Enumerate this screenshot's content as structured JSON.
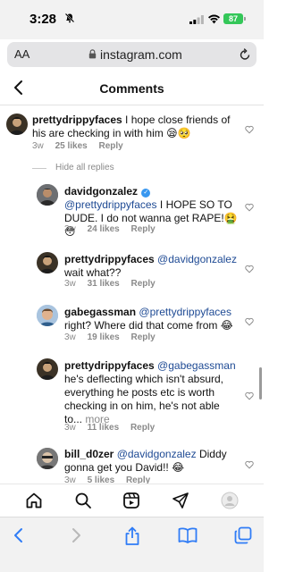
{
  "status_bar": {
    "time": "3:28",
    "battery": "87"
  },
  "url_bar": {
    "text_size_label": "AA",
    "domain": "instagram.com"
  },
  "header": {
    "title": "Comments"
  },
  "comments": [
    {
      "username": "prettydrippyfaces",
      "text": "I hope close friends of his are checking in with him 😪🥺",
      "age": "3w",
      "likes": "25 likes",
      "reply": "Reply"
    },
    {
      "username": "davidgonzalez",
      "mention": "@prettydrippyfaces",
      "text": "I HOPE SO TO DUDE. I do not wanna get RAPE!🤮😳",
      "age": "3w",
      "likes": "24 likes",
      "reply": "Reply"
    },
    {
      "username": "prettydrippyfaces",
      "mention": "@davidgonzalez",
      "text": "wait what??",
      "age": "3w",
      "likes": "31 likes",
      "reply": "Reply"
    },
    {
      "username": "gabegassman",
      "mention": "@prettydrippyfaces",
      "text": "right? Where did that come from 😂",
      "age": "3w",
      "likes": "19 likes",
      "reply": "Reply"
    },
    {
      "username": "prettydrippyfaces",
      "mention": "@gabegassman",
      "text": "he's deflecting which isn't absurd, everything he posts etc is worth checking in on him, he's not able to...",
      "more": "more",
      "age": "3w",
      "likes": "11 likes",
      "reply": "Reply"
    },
    {
      "username": "bill_d0zer",
      "mention": "@davidgonzalez",
      "text": "Diddy gonna get you David!! 😂",
      "age": "3w",
      "likes": "5 likes",
      "reply": "Reply"
    }
  ],
  "hide_replies": "Hide all replies",
  "icons": {
    "home": "home-icon",
    "search": "search-icon",
    "reels": "reels-icon",
    "send": "send-icon",
    "profile": "profile-icon",
    "back": "chevron-left-icon",
    "forward": "chevron-right-icon",
    "share": "share-icon",
    "bookmarks": "book-icon",
    "tabs": "tabs-icon"
  },
  "colors": {
    "accent": "#1e4a94",
    "safari_blue": "#2f7cf6",
    "battery": "#34c759",
    "verified": "#3897f0"
  }
}
